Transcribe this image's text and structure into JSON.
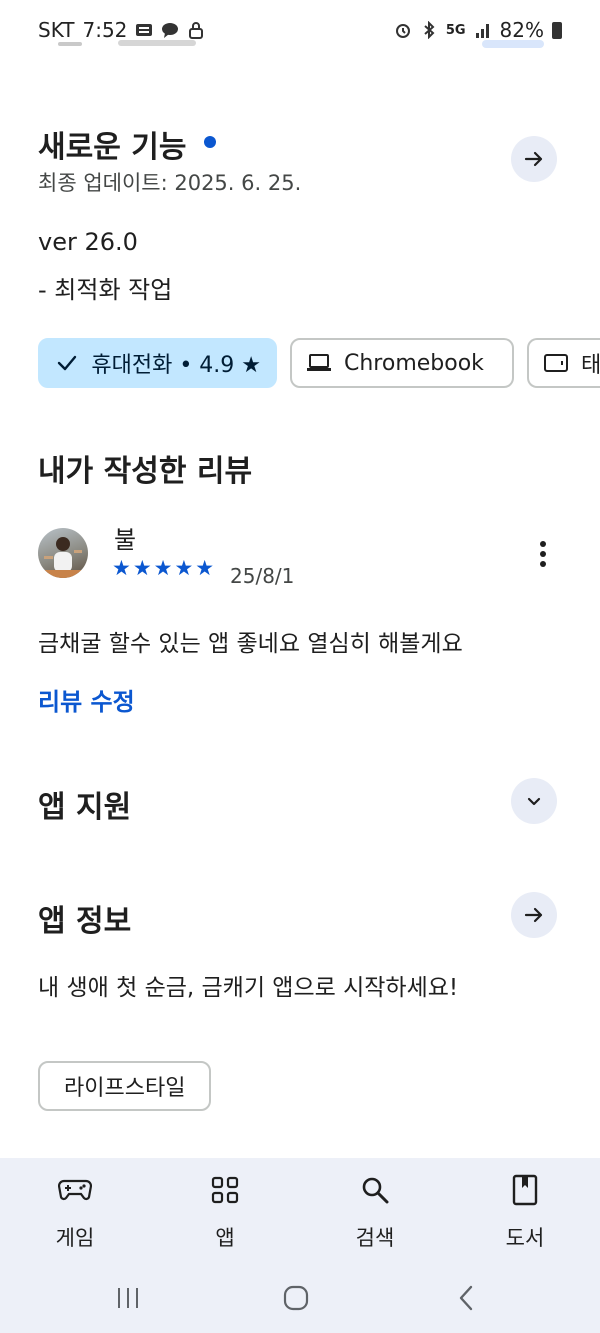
{
  "status_bar": {
    "carrier": "SKT",
    "time": "7:52",
    "network": "5G",
    "battery": "82%",
    "icons": [
      "webtoon-icon",
      "chat-icon",
      "lock-icon",
      "alarm-icon",
      "bluetooth-icon",
      "signal-icon",
      "battery-icon"
    ]
  },
  "whats_new": {
    "title": "새로운 기능",
    "last_updated": "최종 업데이트: 2025. 6. 25.",
    "version": "ver 26.0",
    "notes": "- 최적화 작업"
  },
  "device_chips": [
    {
      "label": "휴대전화 • 4.9 ★",
      "selected": true,
      "icon": "check-icon"
    },
    {
      "label": "Chromebook",
      "selected": false,
      "icon": "laptop-icon"
    },
    {
      "label": "태",
      "selected": false,
      "icon": "tablet-icon"
    }
  ],
  "my_review": {
    "title": "내가 작성한 리뷰",
    "reviewer_name": "불",
    "rating": 5,
    "stars": "★★★★★",
    "date": "25/8/1",
    "text": "금채굴  할수 있는 앱 좋네요 열심히 해볼게요",
    "edit_label": "리뷰 수정"
  },
  "app_support": {
    "title": "앱 지원"
  },
  "app_info": {
    "title": "앱 정보",
    "description": "내 생애 첫 순금, 금캐기 앱으로 시작하세요!",
    "category_tag": "라이프스타일"
  },
  "bottom_nav": [
    {
      "label": "게임",
      "icon": "gamepad-icon"
    },
    {
      "label": "앱",
      "icon": "apps-grid-icon"
    },
    {
      "label": "검색",
      "icon": "search-icon"
    },
    {
      "label": "도서",
      "icon": "book-icon"
    }
  ],
  "colors": {
    "accent": "#0b57d0",
    "chip_selected_bg": "#c2e7ff",
    "nav_bg": "#edf0f8",
    "arrow_btn_bg": "#e8ecf6"
  }
}
